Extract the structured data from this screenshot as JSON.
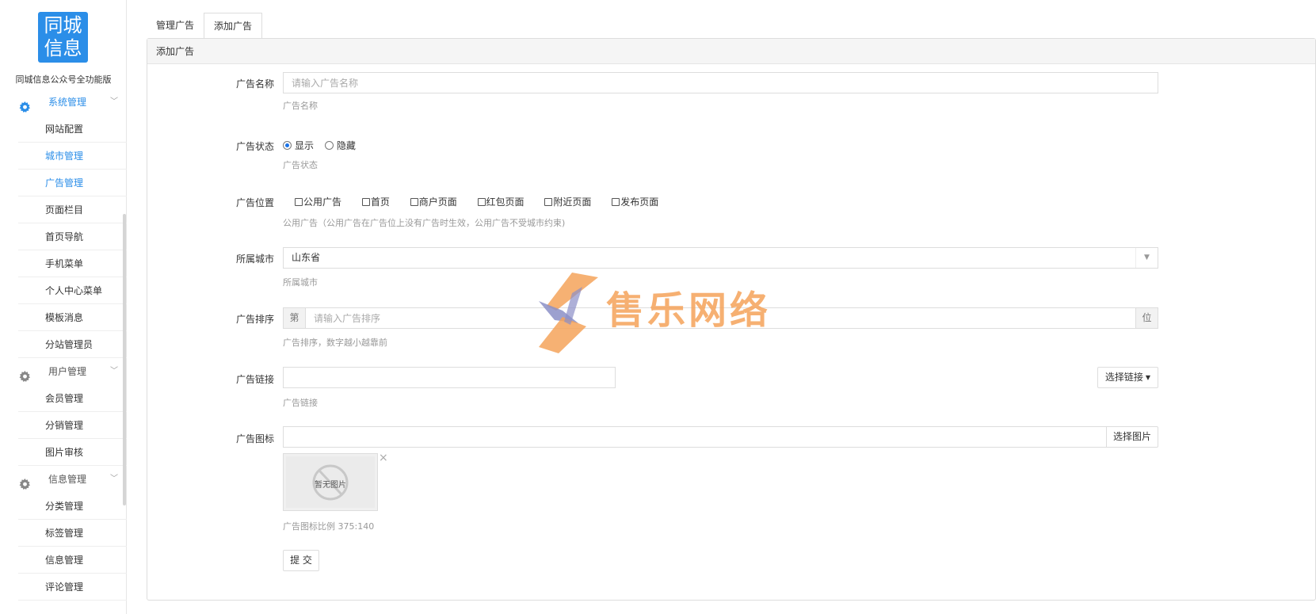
{
  "sidebar": {
    "logo_line1": "同城",
    "logo_line2": "信息",
    "app_name": "同城信息公众号全功能版",
    "groups": [
      {
        "label": "系统管理",
        "icon": "gear-icon",
        "items": [
          "网站配置",
          "城市管理",
          "广告管理",
          "页面栏目",
          "首页导航",
          "手机菜单",
          "个人中心菜单",
          "模板消息",
          "分站管理员"
        ]
      },
      {
        "label": "用户管理",
        "icon": "gear-icon",
        "items": [
          "会员管理",
          "分销管理",
          "图片审核"
        ]
      },
      {
        "label": "信息管理",
        "icon": "gear-icon",
        "items": [
          "分类管理",
          "标签管理",
          "信息管理",
          "评论管理"
        ]
      }
    ]
  },
  "tabs": [
    "管理广告",
    "添加广告"
  ],
  "panel_title": "添加广告",
  "form": {
    "name": {
      "label": "广告名称",
      "placeholder": "请输入广告名称",
      "help": "广告名称"
    },
    "status": {
      "label": "广告状态",
      "options": [
        "显示",
        "隐藏"
      ],
      "selected": "显示",
      "help": "广告状态"
    },
    "position": {
      "label": "广告位置",
      "options": [
        "公用广告",
        "首页",
        "商户页面",
        "红包页面",
        "附近页面",
        "发布页面"
      ],
      "help": "公用广告（公用广告在广告位上没有广告时生效，公用广告不受城市约束)"
    },
    "city": {
      "label": "所属城市",
      "value": "山东省",
      "help": "所属城市"
    },
    "order": {
      "label": "广告排序",
      "prefix": "第",
      "placeholder": "请输入广告排序",
      "suffix": "位",
      "help": "广告排序，数字越小越靠前"
    },
    "link": {
      "label": "广告链接",
      "button": "选择链接",
      "help": "广告链接"
    },
    "icon": {
      "label": "广告图标",
      "button": "选择图片",
      "no_image": "暂无图片",
      "help": "广告图标比例 375:140"
    },
    "submit": "提 交"
  },
  "watermark": "售乐网络",
  "colors": {
    "accent": "#2b8ee8",
    "watermark": "#f5a35a"
  }
}
